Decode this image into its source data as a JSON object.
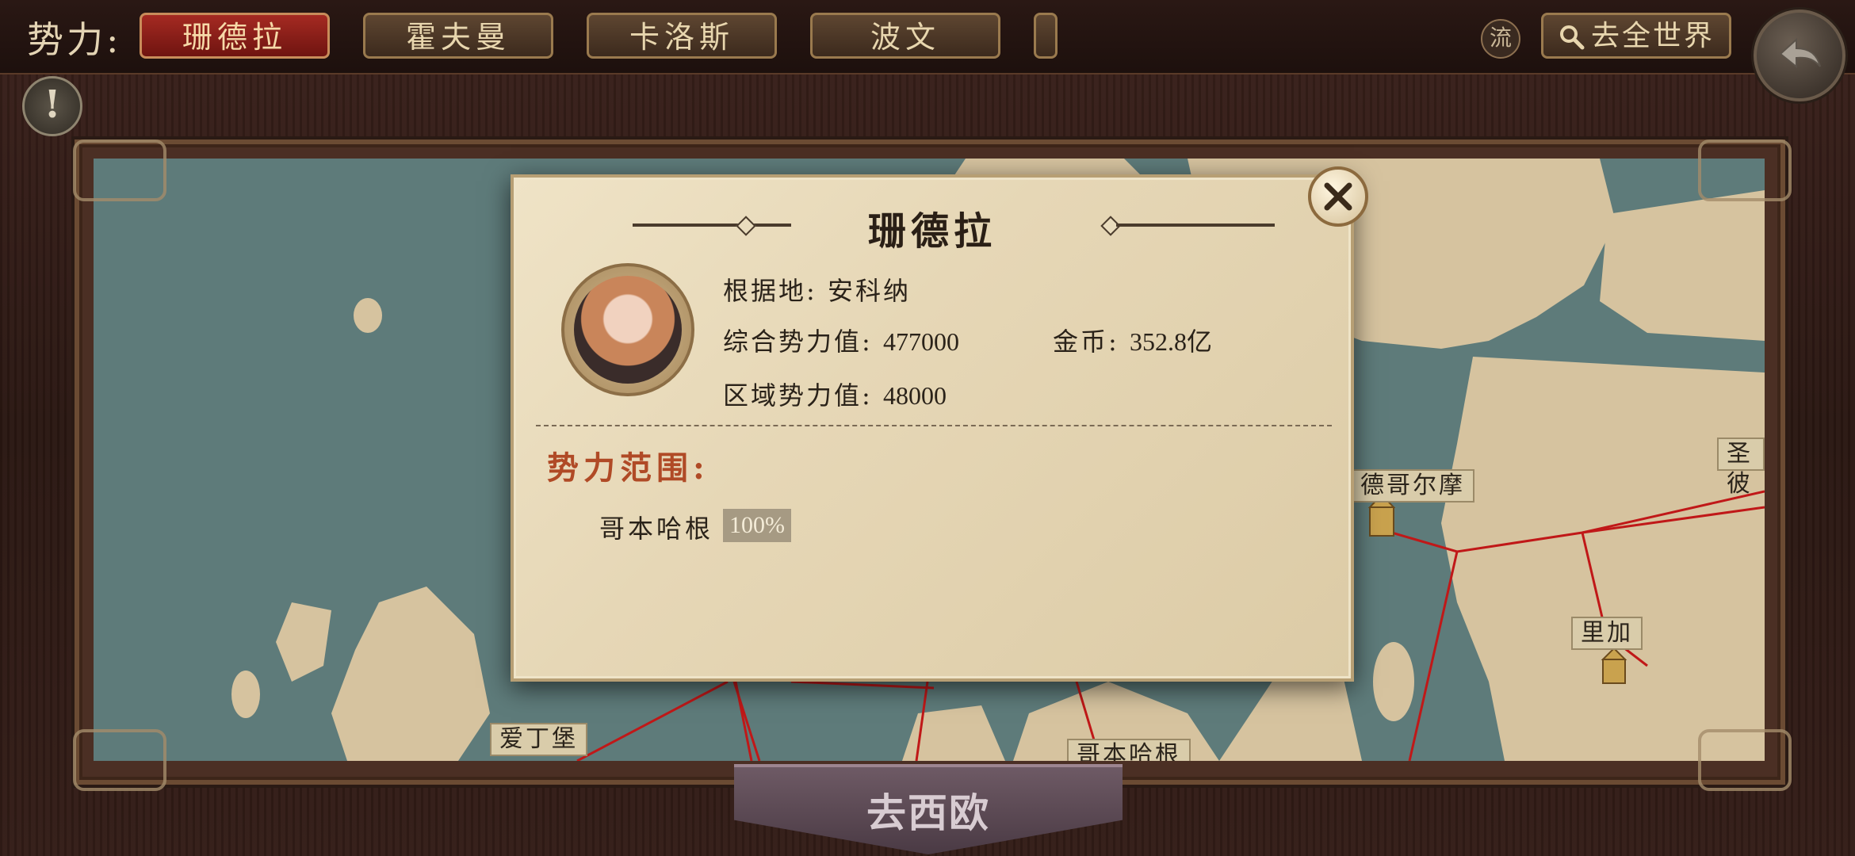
{
  "header": {
    "faction_label": "势力:",
    "tabs": [
      {
        "label": "珊德拉",
        "active": true
      },
      {
        "label": "霍夫曼",
        "active": false
      },
      {
        "label": "卡洛斯",
        "active": false
      },
      {
        "label": "波文",
        "active": false
      }
    ],
    "stream_label": "流",
    "world_button_label": "去全世界"
  },
  "map": {
    "cities": [
      "德哥尔摩",
      "里加",
      "爱丁堡",
      "哥本哈根",
      "圣彼"
    ],
    "goto_button": "去西欧"
  },
  "dialog": {
    "title": "珊德拉",
    "base_label": "根据地:",
    "base_value": "安科纳",
    "power_label": "综合势力值:",
    "power_value": "477000",
    "gold_label": "金币:",
    "gold_value": "352.8亿",
    "region_label": "区域势力值:",
    "region_value": "48000",
    "range_title": "势力范围:",
    "territory": {
      "name": "哥本哈根",
      "percent": "100%"
    }
  },
  "colors": {
    "active_tab": "#a52a22",
    "sea": "#5e7b7a",
    "land": "#d6c39f",
    "route": "#c01818",
    "range_title": "#b04a26"
  }
}
